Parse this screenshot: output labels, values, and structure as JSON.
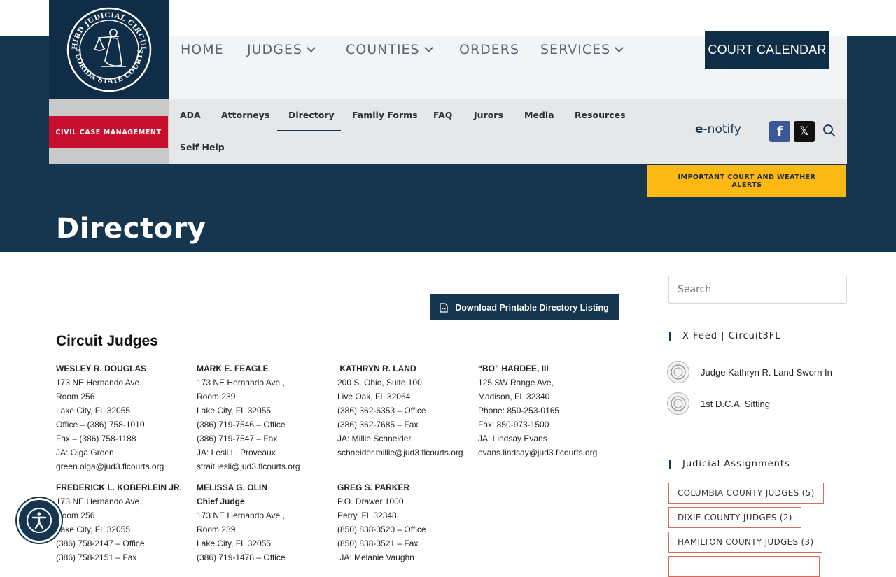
{
  "logo": {
    "top_text": "THIRD JUDICIAL CIRCUIT",
    "bottom_text": "FLORIDA STATE COURTS",
    "icon": "scales-of-justice-seal"
  },
  "main_nav": [
    {
      "label": "HOME",
      "has_dropdown": false
    },
    {
      "label": "JUDGES",
      "has_dropdown": true
    },
    {
      "label": "COUNTIES",
      "has_dropdown": true
    },
    {
      "label": "ORDERS",
      "has_dropdown": false
    },
    {
      "label": "SERVICES",
      "has_dropdown": true
    }
  ],
  "court_calendar_label": "COURT CALENDAR",
  "civil_case_label": "CIVIL CASE MANAGEMENT",
  "sub_nav": [
    "ADA",
    "Attorneys",
    "Directory",
    "Family Forms",
    "FAQ",
    "Jurors",
    "Media",
    "Resources",
    "Self Help"
  ],
  "sub_nav_active": "Directory",
  "enotify": {
    "e": "e",
    "rest": "-notify"
  },
  "social": {
    "facebook": "f",
    "x": "𝕏"
  },
  "alert_label": "IMPORTANT COURT AND WEATHER ALERTS",
  "page_title": "Directory",
  "download_label": "Download Printable Directory Listing",
  "section_title": "Circuit Judges",
  "judges_row1": [
    {
      "name": "WESLEY R. DOUGLAS",
      "lines": [
        "173 NE Hernando Ave.,",
        "Room 256",
        "Lake City, FL 32055",
        "Office – (386) 758-1010",
        "Fax – (386) 758-1188",
        "JA: Olga Green",
        "green.olga@jud3.flcourts.org"
      ]
    },
    {
      "name": "MARK E. FEAGLE",
      "lines": [
        "173 NE Hernando Ave.,",
        "Room 239",
        "Lake City, FL  32055",
        "(386) 719-7546 – Office",
        "(386) 719-7547 – Fax",
        "JA:  Lesli L. Proveaux",
        "strait.lesli@jud3.flcourts.org"
      ]
    },
    {
      "name": " KATHRYN R. LAND",
      "lines": [
        "200 S. Ohio, Suite 100",
        "Live Oak, FL  32064",
        "(386) 362-6353 – Office",
        "(386) 362-7685 – Fax",
        "JA:  Millie Schneider",
        "schneider.millie@jud3.flcourts.org"
      ]
    },
    {
      "name": "“BO” HARDEE, III",
      "lines": [
        "125 SW Range Ave,",
        "Madison, FL 32340",
        "Phone: 850-253-0165",
        "Fax: 850-973-1500",
        "JA: Lindsay Evans",
        "evans.lindsay@jud3.flcourts.org"
      ]
    }
  ],
  "judges_row2": [
    {
      "name": "FREDERICK L. KOBERLEIN JR.",
      "lines": [
        "173 NE Hernando Ave.,",
        "Room 256",
        "Lake City, FL  32055",
        "(386) 758-2147 – Office",
        "(386) 758-2151 – Fax"
      ]
    },
    {
      "name": "MELISSA G. OLIN",
      "lines": [
        "Chief Judge",
        "173 NE Hernando Ave.,",
        "Room 239",
        "Lake City, FL 32055",
        "(386) 719-1478 – Office"
      ]
    },
    {
      "name": "GREG S. PARKER",
      "lines": [
        "P.O. Drawer 1000",
        "Perry, FL  32348",
        "(850) 838-3520 – Office",
        "(850) 838-3521 – Fax",
        " JA: Melanie Vaughn"
      ]
    }
  ],
  "sidebar": {
    "search_placeholder": "Search",
    "x_feed_title": "X Feed | Circuit3FL",
    "feed": [
      "Judge Kathryn R. Land Sworn In",
      "1st D.C.A. Sitting"
    ],
    "assignments_title": "Judicial Assignments",
    "assignments": [
      "COLUMBIA COUNTY JUDGES (5)",
      "DIXIE COUNTY JUDGES (2)",
      "HAMILTON COUNTY JUDGES (3)"
    ]
  }
}
